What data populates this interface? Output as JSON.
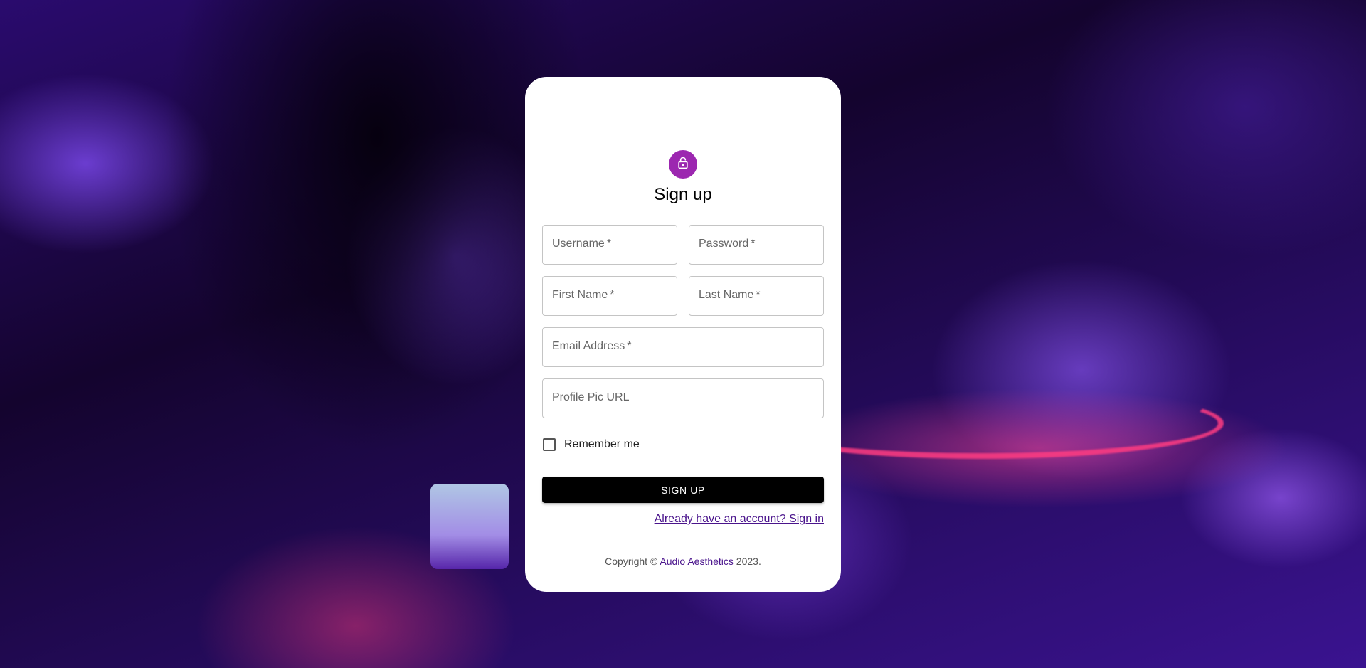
{
  "form": {
    "title": "Sign up",
    "fields": {
      "username": {
        "label": "Username",
        "required": "*",
        "value": ""
      },
      "password": {
        "label": "Password",
        "required": "*",
        "value": ""
      },
      "first_name": {
        "label": "First Name",
        "required": "*",
        "value": ""
      },
      "last_name": {
        "label": "Last Name",
        "required": "*",
        "value": ""
      },
      "email": {
        "label": "Email Address",
        "required": "*",
        "value": ""
      },
      "profile_pic": {
        "label": "Profile Pic URL",
        "value": ""
      }
    },
    "remember_label": "Remember me",
    "remember_checked": false,
    "submit_label": "SIGN UP",
    "signin_link": "Already have an account? Sign in"
  },
  "footer": {
    "prefix": "Copyright ©",
    "brand": "Audio Aesthetics",
    "suffix": "2023."
  },
  "icons": {
    "avatar": "lock-icon"
  },
  "colors": {
    "avatar_bg": "#9c27b0",
    "button_bg": "#000000",
    "link": "#4a148c"
  }
}
